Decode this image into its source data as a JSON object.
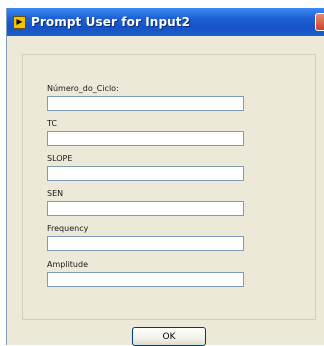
{
  "window": {
    "title": "Prompt User for Input2",
    "icon": "labview-arrow-icon"
  },
  "fields": [
    {
      "label": "Número_do_Ciclo:",
      "value": ""
    },
    {
      "label": "TC",
      "value": ""
    },
    {
      "label": "SLOPE",
      "value": ""
    },
    {
      "label": "SEN",
      "value": ""
    },
    {
      "label": "Frequency",
      "value": ""
    },
    {
      "label": "Amplitude",
      "value": ""
    }
  ],
  "buttons": {
    "ok_label": "OK"
  },
  "colors": {
    "titlebar": "#1f62d6",
    "dialog_bg": "#ECE9D8",
    "input_border": "#7f9db9"
  }
}
